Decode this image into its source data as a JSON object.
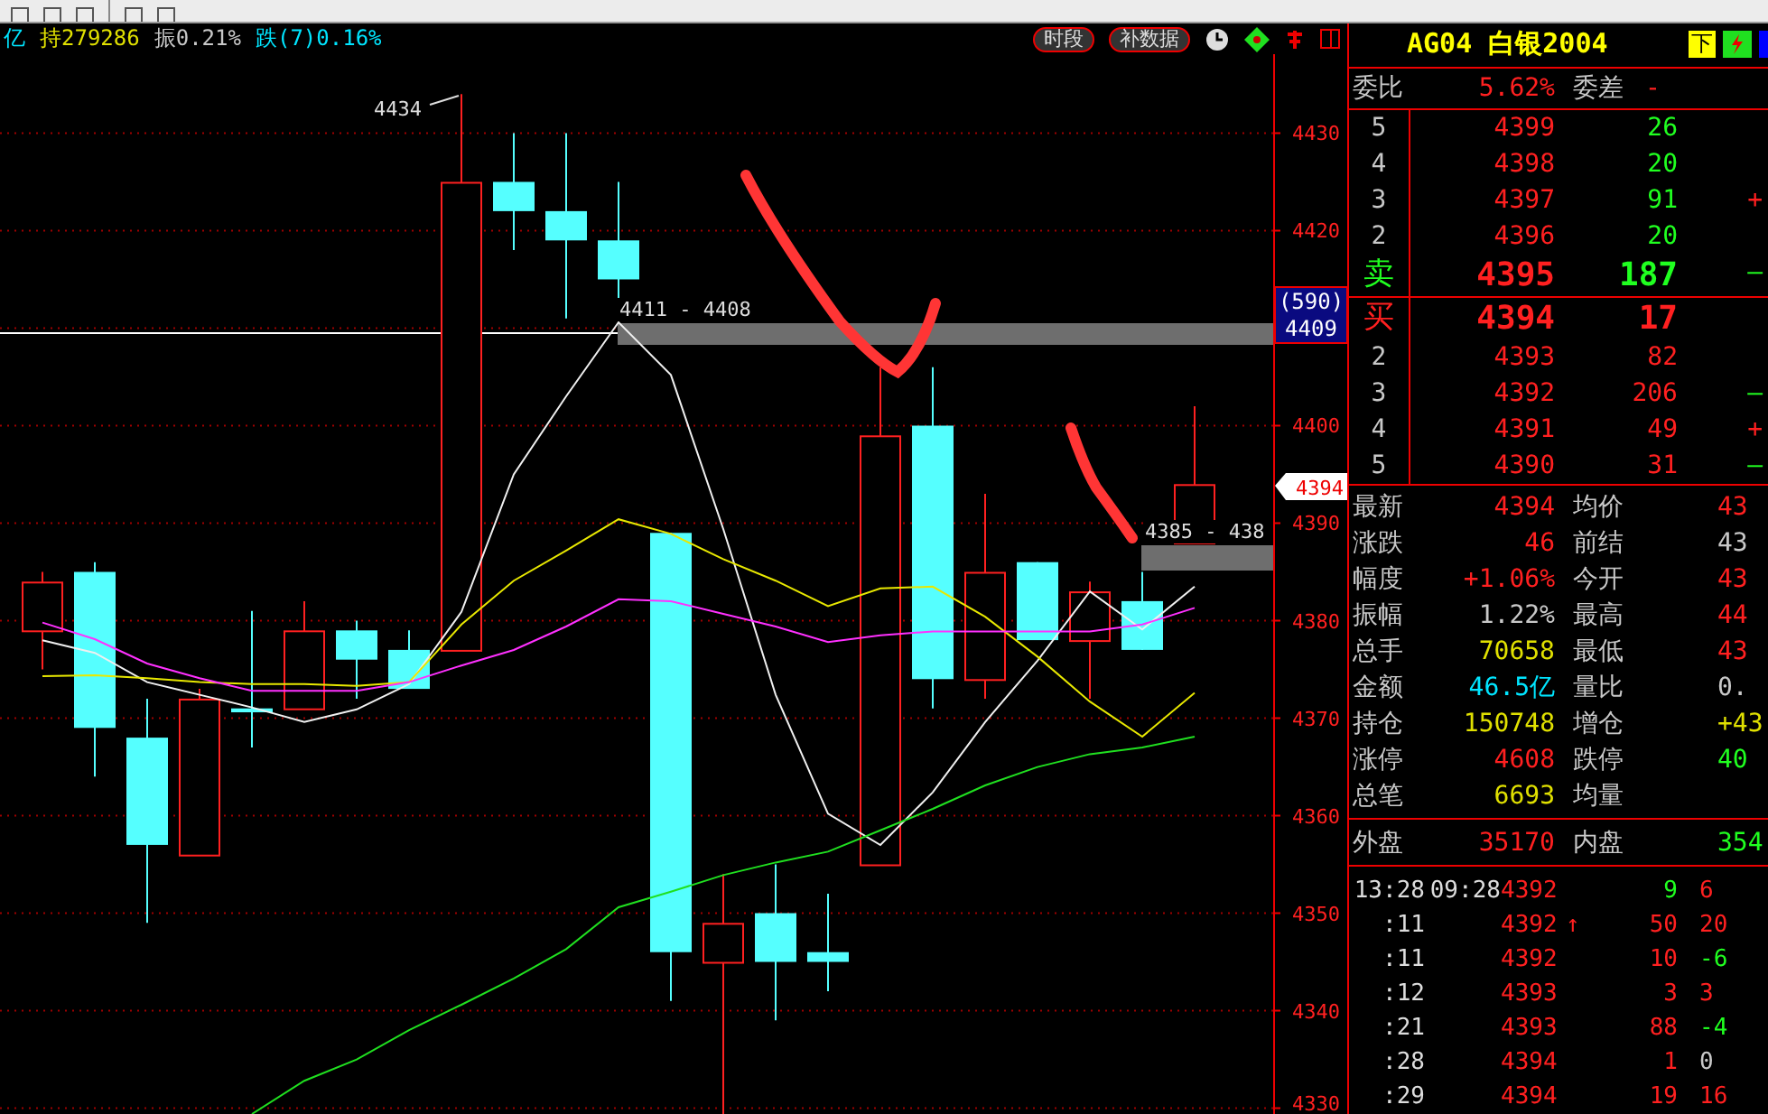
{
  "info_bar": {
    "items": [
      {
        "text": "亿",
        "color": "#00e5ff"
      },
      {
        "text": "持279286",
        "color": "#e0e000"
      },
      {
        "text": "振0.21%",
        "color": "#c8c8c8"
      },
      {
        "text": "跌(7)0.16%",
        "color": "#00e5ff"
      }
    ],
    "buttons": [
      "时段",
      "补数据"
    ]
  },
  "chart": {
    "chart_data": {
      "type": "line",
      "grid": true,
      "ylim": [
        4329.4,
        4438.1
      ],
      "yticks": [
        4330,
        4340,
        4350,
        4360,
        4370,
        4380,
        4390,
        4400,
        4420,
        4430
      ],
      "series": [
        {
          "color": "#f0f0f0",
          "values": [
            4378.0,
            4376.7,
            4373.7,
            4372.4,
            4371.1,
            4369.6,
            4370.9,
            4373.5,
            4380.9,
            4395.0,
            4403.0,
            4410.6,
            4405.2,
            4389.4,
            4372.4,
            4360.2,
            4357.0,
            4362.4,
            4369.6,
            4375.9,
            4383.0,
            4379.1,
            4383.5
          ]
        },
        {
          "color": "#e8e800",
          "values": [
            4374.3,
            4374.4,
            4374.1,
            4373.7,
            4373.5,
            4373.5,
            4373.3,
            4373.7,
            4379.6,
            4384.1,
            4387.2,
            4390.4,
            4388.9,
            4386.3,
            4384.1,
            4381.5,
            4383.3,
            4383.5,
            4380.4,
            4376.3,
            4371.7,
            4368.1,
            4372.6
          ]
        },
        {
          "color": "#ff30ff",
          "values": [
            4379.8,
            4378.1,
            4375.6,
            4374.1,
            4372.8,
            4372.8,
            4372.8,
            4373.7,
            4375.4,
            4377.0,
            4379.4,
            4382.2,
            4382.0,
            4380.7,
            4379.4,
            4377.8,
            4378.5,
            4378.9,
            4378.9,
            4378.9,
            4378.9,
            4379.6,
            4381.3
          ]
        },
        {
          "color": "#20e020",
          "values": [
            null,
            null,
            null,
            null,
            4329.4,
            4332.8,
            4335.0,
            4338.0,
            4340.6,
            4343.3,
            4346.3,
            4350.6,
            4352.2,
            4353.9,
            4355.2,
            4356.3,
            4358.5,
            4360.7,
            4363.1,
            4365.0,
            4366.3,
            4367.0,
            4368.1
          ]
        }
      ]
    },
    "zones": [
      {
        "label": "4411 - 4408"
      },
      {
        "label": "4385 - 438"
      }
    ],
    "high_label": "4434",
    "cursor_label": {
      "volume": "(590)",
      "price": "4409"
    },
    "last_price_tag": "4394"
  },
  "quote": {
    "title": "AG04 白银2004",
    "badges": [
      "下"
    ],
    "ratio": {
      "label": "委比",
      "value": "5.62%",
      "label2": "委差",
      "value2": "-"
    },
    "asks": [
      {
        "level": "5",
        "price": "4399",
        "volume": "26",
        "kind": "normal"
      },
      {
        "level": "4",
        "price": "4398",
        "volume": "20",
        "kind": "normal"
      },
      {
        "level": "3",
        "price": "4397",
        "volume": "91",
        "kind": "normal",
        "mark": "+"
      },
      {
        "level": "2",
        "price": "4396",
        "volume": "20",
        "kind": "normal"
      },
      {
        "level": "卖",
        "price": "4395",
        "volume": "187",
        "kind": "best",
        "mark": "—"
      }
    ],
    "bids": [
      {
        "level": "买",
        "price": "4394",
        "volume": "17",
        "kind": "best"
      },
      {
        "level": "2",
        "price": "4393",
        "volume": "82",
        "kind": "normal"
      },
      {
        "level": "3",
        "price": "4392",
        "volume": "206",
        "kind": "normal",
        "mark": "—"
      },
      {
        "level": "4",
        "price": "4391",
        "volume": "49",
        "kind": "normal",
        "mark": "+"
      },
      {
        "level": "5",
        "price": "4390",
        "volume": "31",
        "kind": "normal",
        "mark": "—"
      }
    ],
    "stats": [
      {
        "left": {
          "label": "最新",
          "value": "4394",
          "color": "#ff2020"
        },
        "right": {
          "label": "均价",
          "value": "43",
          "color": "#ff2020"
        }
      },
      {
        "left": {
          "label": "涨跌",
          "value": "46",
          "color": "#ff2020"
        },
        "right": {
          "label": "前结",
          "value": "43",
          "color": "#c8c8c8"
        }
      },
      {
        "left": {
          "label": "幅度",
          "value": "+1.06%",
          "color": "#ff2020"
        },
        "right": {
          "label": "今开",
          "value": "43",
          "color": "#ff2020"
        }
      },
      {
        "left": {
          "label": "振幅",
          "value": "1.22%",
          "color": "#c8c8c8"
        },
        "right": {
          "label": "最高",
          "value": "44",
          "color": "#ff2020"
        }
      },
      {
        "left": {
          "label": "总手",
          "value": "70658",
          "color": "#e0e000"
        },
        "right": {
          "label": "最低",
          "value": "43",
          "color": "#ff2020"
        }
      },
      {
        "left": {
          "label": "金额",
          "value": "46.5亿",
          "color": "#00e5ff"
        },
        "right": {
          "label": "量比",
          "value": "0.",
          "color": "#c8c8c8"
        }
      },
      {
        "left": {
          "label": "持仓",
          "value": "150748",
          "color": "#e0e000"
        },
        "right": {
          "label": "增仓",
          "value": "+43",
          "color": "#e0e000"
        }
      },
      {
        "left": {
          "label": "涨停",
          "value": "4608",
          "color": "#ff2020"
        },
        "right": {
          "label": "跌停",
          "value": "40",
          "color": "#20ff20"
        }
      },
      {
        "left": {
          "label": "总笔",
          "value": "6693",
          "color": "#e0e000"
        },
        "right": {
          "label": "均量"
        }
      }
    ],
    "outer": {
      "label": "外盘",
      "value": "35170",
      "label2": "内盘",
      "value2": "354"
    },
    "ticks": [
      {
        "time": "13:28",
        "time2": "09:28",
        "price": "4392",
        "volume": {
          "text": "9",
          "color": "#20ff20"
        },
        "change": {
          "text": "6",
          "color": "#ff2020"
        }
      },
      {
        "time": ":11",
        "price": "4392",
        "arrow": "↑",
        "volume": {
          "text": "50",
          "color": "#ff2020"
        },
        "change": {
          "text": "20",
          "color": "#ff2020"
        }
      },
      {
        "time": ":11",
        "price": "4392",
        "volume": {
          "text": "10",
          "color": "#ff2020"
        },
        "change": {
          "text": "-6",
          "color": "#20ff20"
        }
      },
      {
        "time": ":12",
        "price": "4393",
        "volume": {
          "text": "3",
          "color": "#ff2020"
        },
        "change": {
          "text": "3",
          "color": "#ff2020"
        }
      },
      {
        "time": ":21",
        "price": "4393",
        "volume": {
          "text": "88",
          "color": "#ff2020"
        },
        "change": {
          "text": "-4",
          "color": "#20ff20"
        }
      },
      {
        "time": ":28",
        "price": "4394",
        "volume": {
          "text": "1",
          "color": "#ff2020"
        },
        "change": {
          "text": "0",
          "color": "#c8c8c8"
        }
      },
      {
        "time": ":29",
        "price": "4394",
        "volume": {
          "text": "19",
          "color": "#ff2020"
        },
        "change": {
          "text": "16",
          "color": "#ff2020"
        }
      }
    ]
  }
}
